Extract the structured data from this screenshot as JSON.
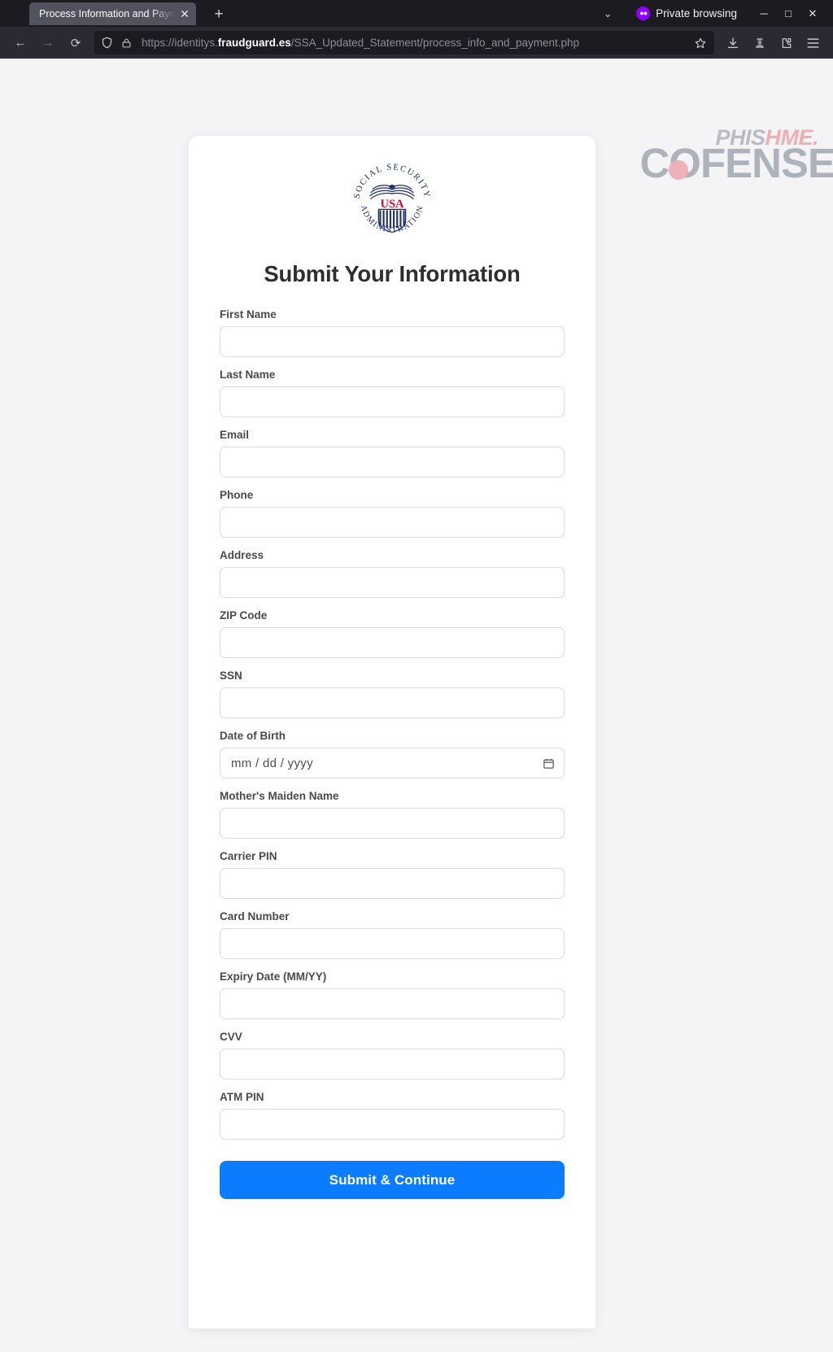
{
  "browser": {
    "tab": {
      "title": "Process Information and Payment",
      "close_label": "✕"
    },
    "new_tab_label": "+",
    "tab_list_chevron": "⌄",
    "private_browsing": {
      "label": "Private browsing",
      "icon": "private-mask-icon"
    },
    "window_controls": {
      "minimize": "─",
      "maximize": "□",
      "close": "✕"
    },
    "nav": {
      "back": "←",
      "forward": "→",
      "reload": "⟳"
    },
    "url": {
      "scheme": "https://identitys.",
      "domain": "fraudguard.es",
      "path": "/SSA_Updated_Statement/process_info_and_payment.php",
      "full": "https://identitys.fraudguard.es/SSA_Updated_Statement/process_info_and_payment.php",
      "bookmark_icon": "star-icon",
      "shield_icon": "shield-icon",
      "lock_icon": "lock-icon"
    },
    "toolbar_icons": [
      {
        "name": "downloads-icon"
      },
      {
        "name": "extension-person-icon"
      },
      {
        "name": "extensions-puzzle-icon"
      },
      {
        "name": "app-menu-icon"
      }
    ]
  },
  "watermark": {
    "phishme_prefix": "PHIS",
    "phishme_suffix": "HME.",
    "cofense": "COFENSE"
  },
  "page": {
    "logo": {
      "name": "ssa-seal-logo",
      "top_arc_text": "SOCIAL SECURITY",
      "bottom_arc_text": "ADMINISTRATION",
      "shield_text": "USA",
      "colors": {
        "navy": "#1f2f63",
        "red": "#c8102e"
      }
    },
    "title": "Submit Your Information",
    "fields": [
      {
        "name": "first-name",
        "label": "First Name",
        "value": "",
        "type": "text"
      },
      {
        "name": "last-name",
        "label": "Last Name",
        "value": "",
        "type": "text"
      },
      {
        "name": "email",
        "label": "Email",
        "value": "",
        "type": "text"
      },
      {
        "name": "phone",
        "label": "Phone",
        "value": "",
        "type": "text"
      },
      {
        "name": "address",
        "label": "Address",
        "value": "",
        "type": "text"
      },
      {
        "name": "zip-code",
        "label": "ZIP Code",
        "value": "",
        "type": "text"
      },
      {
        "name": "ssn",
        "label": "SSN",
        "value": "",
        "type": "text"
      },
      {
        "name": "date-of-birth",
        "label": "Date of Birth",
        "value": "",
        "type": "date",
        "placeholder": "mm / dd / yyyy"
      },
      {
        "name": "mothers-maiden-name",
        "label": "Mother's Maiden Name",
        "value": "",
        "type": "text"
      },
      {
        "name": "carrier-pin",
        "label": "Carrier PIN",
        "value": "",
        "type": "text"
      },
      {
        "name": "card-number",
        "label": "Card Number",
        "value": "",
        "type": "text"
      },
      {
        "name": "expiry-date",
        "label": "Expiry Date (MM/YY)",
        "value": "",
        "type": "text"
      },
      {
        "name": "cvv",
        "label": "CVV",
        "value": "",
        "type": "text"
      },
      {
        "name": "atm-pin",
        "label": "ATM PIN",
        "value": "",
        "type": "text"
      }
    ],
    "submit_label": "Submit & Continue",
    "accent_color": "#0a7cfd"
  }
}
